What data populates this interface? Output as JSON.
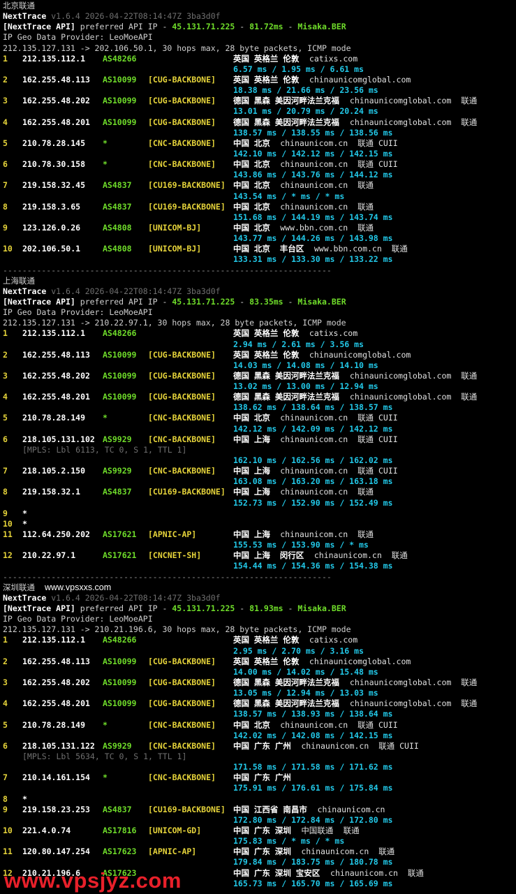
{
  "colors": {
    "background": "#000000",
    "as_green": "#6fdc2a",
    "tag_yellow": "#e5d33a",
    "rtt_cyan": "#22c8e8",
    "watermark_red": "#e8202a"
  },
  "watermark": "www.vpsjyz.com",
  "sections": [
    {
      "title": "北京联通",
      "title_extra": "",
      "header": {
        "tool": "NextTrace",
        "version": "v1.6.4 2026-04-22T08:14:47Z 3ba3d0f",
        "api_prefix": "[NextTrace API]",
        "api_mid": " preferred API IP - ",
        "api_ip": "45.131.71.225",
        "api_sep1": " - ",
        "api_ms": "81.72ms",
        "api_sep2": " - ",
        "api_node": "Misaka.BER",
        "geo_provider": "IP Geo Data Provider: LeoMoeAPI",
        "route": "212.135.127.131 -> 202.106.50.1, 30 hops max, 28 byte packets, ICMP mode"
      },
      "hops": [
        {
          "n": "1",
          "ip": "212.135.112.1",
          "asn": "AS48266",
          "tag": "",
          "geo": "英国 英格兰 伦敦",
          "host": "catixs.com",
          "isp": "",
          "rtt": "6.57 ms / 1.95 ms / 6.61 ms"
        },
        {
          "n": "2",
          "ip": "162.255.48.113",
          "asn": "AS10099",
          "tag": "[CUG-BACKBONE]",
          "geo": "英国 英格兰 伦敦",
          "host": "chinaunicomglobal.com",
          "isp": "",
          "rtt": "18.38 ms / 21.66 ms / 23.56 ms"
        },
        {
          "n": "3",
          "ip": "162.255.48.202",
          "asn": "AS10099",
          "tag": "[CUG-BACKBONE]",
          "geo": "德国 黑森 美因河畔法兰克福",
          "host": "chinaunicomglobal.com",
          "isp": "联通",
          "rtt": "13.01 ms / 20.79 ms / 20.24 ms"
        },
        {
          "n": "4",
          "ip": "162.255.48.201",
          "asn": "AS10099",
          "tag": "[CUG-BACKBONE]",
          "geo": "德国 黑森 美因河畔法兰克福",
          "host": "chinaunicomglobal.com",
          "isp": "联通",
          "rtt": "138.57 ms / 138.55 ms / 138.56 ms"
        },
        {
          "n": "5",
          "ip": "210.78.28.145",
          "asn": "*",
          "tag": "[CNC-BACKBONE]",
          "geo": "中国 北京",
          "host": "chinaunicom.cn",
          "isp": "联通 CUII",
          "rtt": "142.10 ms / 142.12 ms / 142.15 ms"
        },
        {
          "n": "6",
          "ip": "210.78.30.158",
          "asn": "*",
          "tag": "[CNC-BACKBONE]",
          "geo": "中国 北京",
          "host": "chinaunicom.cn",
          "isp": "联通 CUII",
          "rtt": "143.86 ms / 143.76 ms / 144.12 ms"
        },
        {
          "n": "7",
          "ip": "219.158.32.45",
          "asn": "AS4837",
          "tag": "[CU169-BACKBONE]",
          "geo": "中国 北京",
          "host": "chinaunicom.cn",
          "isp": "联通",
          "rtt": "143.54 ms / * ms / * ms"
        },
        {
          "n": "8",
          "ip": "219.158.3.65",
          "asn": "AS4837",
          "tag": "[CU169-BACKBONE]",
          "geo": "中国 北京",
          "host": "chinaunicom.cn",
          "isp": "联通",
          "rtt": "151.68 ms / 144.19 ms / 143.74 ms"
        },
        {
          "n": "9",
          "ip": "123.126.0.26",
          "asn": "AS4808",
          "tag": "[UNICOM-BJ]",
          "geo": "中国 北京",
          "host": "www.bbn.com.cn",
          "isp": "联通",
          "rtt": "143.77 ms / 144.26 ms / 143.98 ms"
        },
        {
          "n": "10",
          "ip": "202.106.50.1",
          "asn": "AS4808",
          "tag": "[UNICOM-BJ]",
          "geo": "中国 北京  丰台区",
          "host": "www.bbn.com.cn",
          "isp": "联通",
          "rtt": "133.31 ms / 133.30 ms / 133.22 ms"
        }
      ]
    },
    {
      "title": "上海联通",
      "title_extra": "",
      "header": {
        "tool": "NextTrace",
        "version": "v1.6.4 2026-04-22T08:14:47Z 3ba3d0f",
        "api_prefix": "[NextTrace API]",
        "api_mid": " preferred API IP - ",
        "api_ip": "45.131.71.225",
        "api_sep1": " - ",
        "api_ms": "83.35ms",
        "api_sep2": " - ",
        "api_node": "Misaka.BER",
        "geo_provider": "IP Geo Data Provider: LeoMoeAPI",
        "route": "212.135.127.131 -> 210.22.97.1, 30 hops max, 28 byte packets, ICMP mode"
      },
      "hops": [
        {
          "n": "1",
          "ip": "212.135.112.1",
          "asn": "AS48266",
          "tag": "",
          "geo": "英国 英格兰 伦敦",
          "host": "catixs.com",
          "isp": "",
          "rtt": "2.94 ms / 2.61 ms / 3.56 ms"
        },
        {
          "n": "2",
          "ip": "162.255.48.113",
          "asn": "AS10099",
          "tag": "[CUG-BACKBONE]",
          "geo": "英国 英格兰 伦敦",
          "host": "chinaunicomglobal.com",
          "isp": "",
          "rtt": "14.03 ms / 14.08 ms / 14.10 ms"
        },
        {
          "n": "3",
          "ip": "162.255.48.202",
          "asn": "AS10099",
          "tag": "[CUG-BACKBONE]",
          "geo": "德国 黑森 美因河畔法兰克福",
          "host": "chinaunicomglobal.com",
          "isp": "联通",
          "rtt": "13.02 ms / 13.00 ms / 12.94 ms"
        },
        {
          "n": "4",
          "ip": "162.255.48.201",
          "asn": "AS10099",
          "tag": "[CUG-BACKBONE]",
          "geo": "德国 黑森 美因河畔法兰克福",
          "host": "chinaunicomglobal.com",
          "isp": "联通",
          "rtt": "138.62 ms / 138.64 ms / 138.57 ms"
        },
        {
          "n": "5",
          "ip": "210.78.28.149",
          "asn": "*",
          "tag": "[CNC-BACKBONE]",
          "geo": "中国 北京",
          "host": "chinaunicom.cn",
          "isp": "联通 CUII",
          "rtt": "142.12 ms / 142.09 ms / 142.12 ms"
        },
        {
          "n": "6",
          "ip": "218.105.131.102",
          "asn": "AS9929",
          "tag": "[CNC-BACKBONE]",
          "geo": "中国 上海",
          "host": "chinaunicom.cn",
          "isp": "联通 CUII",
          "rtt": "162.10 ms / 162.56 ms / 162.02 ms",
          "mpls": "[MPLS: Lbl 6113, TC 0, S 1, TTL 1]"
        },
        {
          "n": "7",
          "ip": "218.105.2.150",
          "asn": "AS9929",
          "tag": "[CNC-BACKBONE]",
          "geo": "中国 上海",
          "host": "chinaunicom.cn",
          "isp": "联通 CUII",
          "rtt": "163.08 ms / 163.20 ms / 163.18 ms"
        },
        {
          "n": "8",
          "ip": "219.158.32.1",
          "asn": "AS4837",
          "tag": "[CU169-BACKBONE]",
          "geo": "中国 上海",
          "host": "chinaunicom.cn",
          "isp": "联通",
          "rtt": "152.73 ms / 152.90 ms / 152.49 ms"
        },
        {
          "n": "9",
          "ip": "*",
          "asn": "",
          "tag": "",
          "geo": "",
          "host": "",
          "isp": "",
          "rtt": ""
        },
        {
          "n": "10",
          "ip": "*",
          "asn": "",
          "tag": "",
          "geo": "",
          "host": "",
          "isp": "",
          "rtt": ""
        },
        {
          "n": "11",
          "ip": "112.64.250.202",
          "asn": "AS17621",
          "tag": "[APNIC-AP]",
          "geo": "中国 上海",
          "host": "chinaunicom.cn",
          "isp": "联通",
          "rtt": "155.53 ms / 153.90 ms / * ms"
        },
        {
          "n": "12",
          "ip": "210.22.97.1",
          "asn": "AS17621",
          "tag": "[CNCNET-SH]",
          "geo": "中国 上海  闵行区",
          "host": "chinaunicom.cn",
          "isp": "联通",
          "rtt": "154.44 ms / 154.36 ms / 154.38 ms"
        }
      ]
    },
    {
      "title": "深圳联通",
      "title_extra": "www.vpsxxs.com",
      "header": {
        "tool": "NextTrace",
        "version": "v1.6.4 2026-04-22T08:14:47Z 3ba3d0f",
        "api_prefix": "[NextTrace API]",
        "api_mid": " preferred API IP - ",
        "api_ip": "45.131.71.225",
        "api_sep1": " - ",
        "api_ms": "81.93ms",
        "api_sep2": " - ",
        "api_node": "Misaka.BER",
        "geo_provider": "IP Geo Data Provider: LeoMoeAPI",
        "route": "212.135.127.131 -> 210.21.196.6, 30 hops max, 28 byte packets, ICMP mode"
      },
      "hops": [
        {
          "n": "1",
          "ip": "212.135.112.1",
          "asn": "AS48266",
          "tag": "",
          "geo": "英国 英格兰 伦敦",
          "host": "catixs.com",
          "isp": "",
          "rtt": "2.95 ms / 2.70 ms / 3.16 ms"
        },
        {
          "n": "2",
          "ip": "162.255.48.113",
          "asn": "AS10099",
          "tag": "[CUG-BACKBONE]",
          "geo": "英国 英格兰 伦敦",
          "host": "chinaunicomglobal.com",
          "isp": "",
          "rtt": "14.00 ms / 14.02 ms / 15.48 ms"
        },
        {
          "n": "3",
          "ip": "162.255.48.202",
          "asn": "AS10099",
          "tag": "[CUG-BACKBONE]",
          "geo": "德国 黑森 美因河畔法兰克福",
          "host": "chinaunicomglobal.com",
          "isp": "联通",
          "rtt": "13.05 ms / 12.94 ms / 13.03 ms"
        },
        {
          "n": "4",
          "ip": "162.255.48.201",
          "asn": "AS10099",
          "tag": "[CUG-BACKBONE]",
          "geo": "德国 黑森 美因河畔法兰克福",
          "host": "chinaunicomglobal.com",
          "isp": "联通",
          "rtt": "138.57 ms / 138.93 ms / 138.64 ms"
        },
        {
          "n": "5",
          "ip": "210.78.28.149",
          "asn": "*",
          "tag": "[CNC-BACKBONE]",
          "geo": "中国 北京",
          "host": "chinaunicom.cn",
          "isp": "联通 CUII",
          "rtt": "142.02 ms / 142.08 ms / 142.15 ms"
        },
        {
          "n": "6",
          "ip": "218.105.131.122",
          "asn": "AS9929",
          "tag": "[CNC-BACKBONE]",
          "geo": "中国 广东 广州",
          "host": "chinaunicom.cn",
          "isp": "联通 CUII",
          "rtt": "171.58 ms / 171.58 ms / 171.62 ms",
          "mpls": "[MPLS: Lbl 5634, TC 0, S 1, TTL 1]"
        },
        {
          "n": "7",
          "ip": "210.14.161.154",
          "asn": "*",
          "tag": "[CNC-BACKBONE]",
          "geo": "中国 广东 广州",
          "host": "",
          "isp": "",
          "rtt": "175.91 ms / 176.61 ms / 175.84 ms"
        },
        {
          "n": "8",
          "ip": "*",
          "asn": "",
          "tag": "",
          "geo": "",
          "host": "",
          "isp": "",
          "rtt": ""
        },
        {
          "n": "9",
          "ip": "219.158.23.253",
          "asn": "AS4837",
          "tag": "[CU169-BACKBONE]",
          "geo": "中国 江西省 南昌市",
          "host": "chinaunicom.cn",
          "isp": "",
          "rtt": "172.80 ms / 172.84 ms / 172.80 ms"
        },
        {
          "n": "10",
          "ip": "221.4.0.74",
          "asn": "AS17816",
          "tag": "[UNICOM-GD]",
          "geo": "中国 广东 深圳",
          "host": "中国联通",
          "isp": "联通",
          "rtt": "175.83 ms / * ms / * ms"
        },
        {
          "n": "11",
          "ip": "120.80.147.254",
          "asn": "AS17623",
          "tag": "[APNIC-AP]",
          "geo": "中国 广东 深圳",
          "host": "chinaunicom.cn",
          "isp": "联通",
          "rtt": "179.84 ms / 183.75 ms / 180.78 ms"
        },
        {
          "n": "12",
          "ip": "210.21.196.6",
          "asn": "AS17623",
          "tag": "",
          "geo": "中国 广东 深圳 宝安区",
          "host": "chinaunicom.cn",
          "isp": "联通",
          "rtt": "165.73 ms / 165.70 ms / 165.69 ms"
        }
      ]
    }
  ],
  "separator": "--------------------------------------------------------------------"
}
